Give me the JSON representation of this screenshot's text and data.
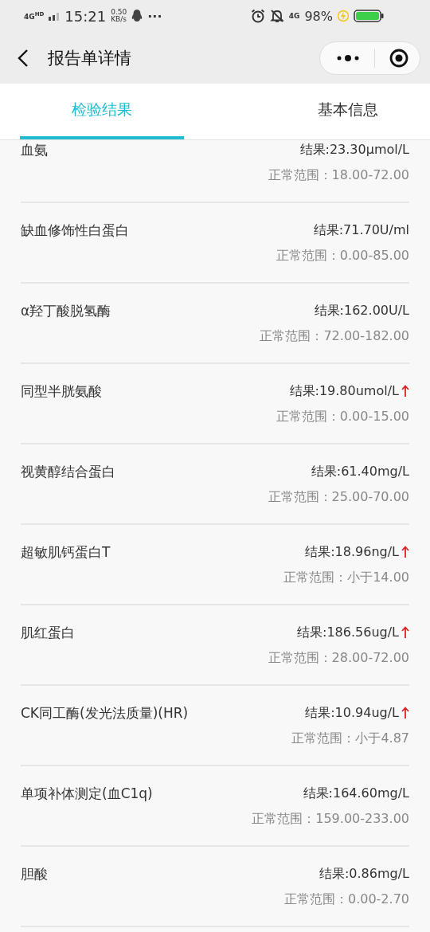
{
  "status_bar": {
    "network": "4G",
    "network_sup": "HD",
    "time": "15:21",
    "speed_value": "0.50",
    "speed_unit": "KB/s",
    "more": "···",
    "network_right": "4G",
    "battery": "98%"
  },
  "header": {
    "title": "报告单详情"
  },
  "tabs": [
    {
      "label": "检验结果",
      "selected": true
    },
    {
      "label": "基本信息",
      "selected": false
    }
  ],
  "results": [
    {
      "name": "血氨",
      "result": "结果:23.30µmol/L",
      "range": "正常范围：18.00-72.00",
      "high": false
    },
    {
      "name": "缺血修饰性白蛋白",
      "result": "结果:71.70U/ml",
      "range": "正常范围：0.00-85.00",
      "high": false
    },
    {
      "name": "α羟丁酸脱氢酶",
      "result": "结果:162.00U/L",
      "range": "正常范围：72.00-182.00",
      "high": false
    },
    {
      "name": "同型半胱氨酸",
      "result": "结果:19.80umol/L",
      "range": "正常范围：0.00-15.00",
      "high": true
    },
    {
      "name": "视黄醇结合蛋白",
      "result": "结果:61.40mg/L",
      "range": "正常范围：25.00-70.00",
      "high": false
    },
    {
      "name": "超敏肌钙蛋白T",
      "result": "结果:18.96ng/L",
      "range": "正常范围：小于14.00",
      "high": true
    },
    {
      "name": "肌红蛋白",
      "result": "结果:186.56ug/L",
      "range": "正常范围：28.00-72.00",
      "high": true
    },
    {
      "name": "CK同工酶(发光法质量)(HR)",
      "result": "结果:10.94ug/L",
      "range": "正常范围：小于4.87",
      "high": true
    },
    {
      "name": "单项补体测定(血C1q)",
      "result": "结果:164.60mg/L",
      "range": "正常范围：159.00-233.00",
      "high": false
    },
    {
      "name": "胆酸",
      "result": "结果:0.86mg/L",
      "range": "正常范围：0.00-2.70",
      "high": false
    }
  ]
}
